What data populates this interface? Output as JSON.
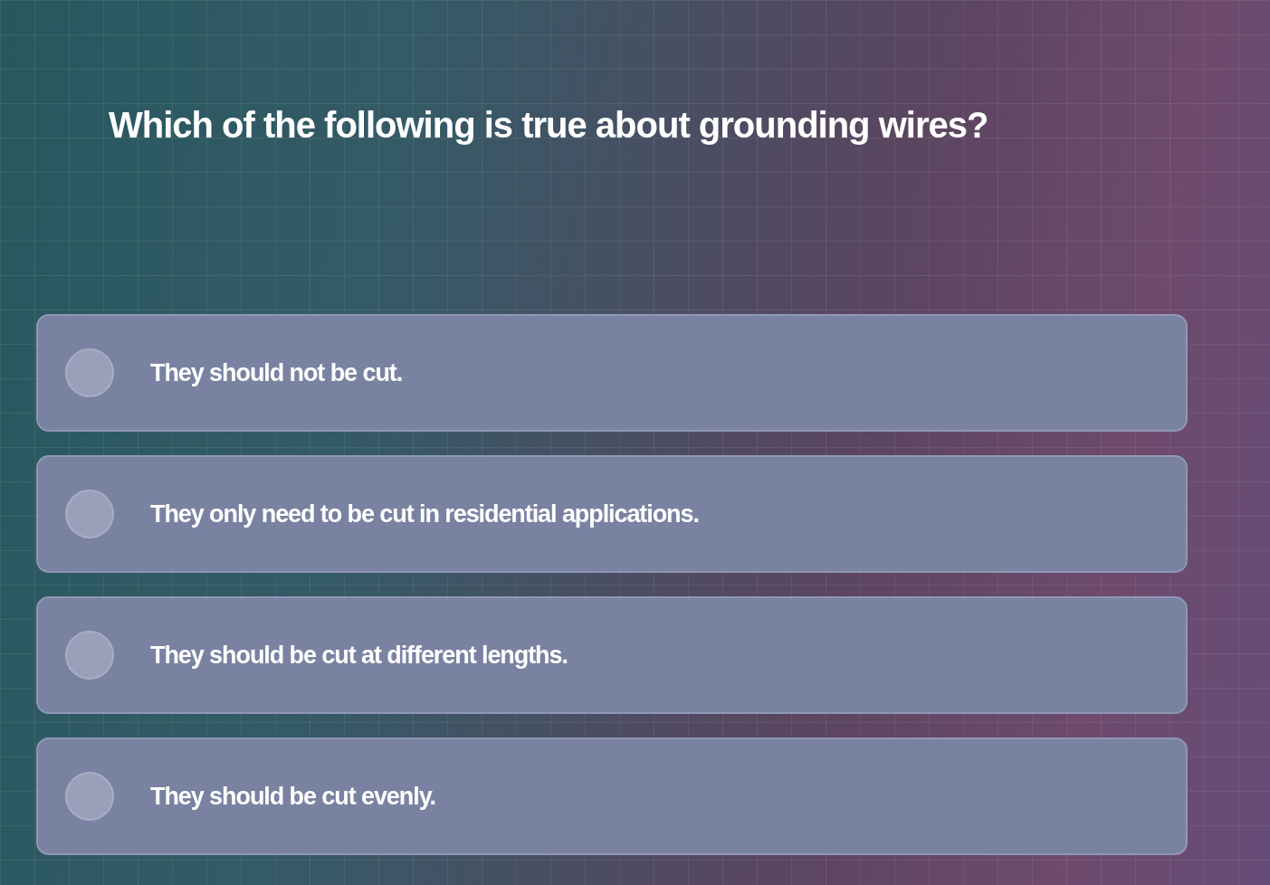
{
  "question": "Which of the following is true about grounding wires?",
  "options": [
    {
      "text": "They should not be cut.",
      "selected": false
    },
    {
      "text": "They only need to be cut in residential applications.",
      "selected": false
    },
    {
      "text": "They should be cut at different lengths.",
      "selected": false
    },
    {
      "text": "They should be cut evenly.",
      "selected": false
    }
  ]
}
